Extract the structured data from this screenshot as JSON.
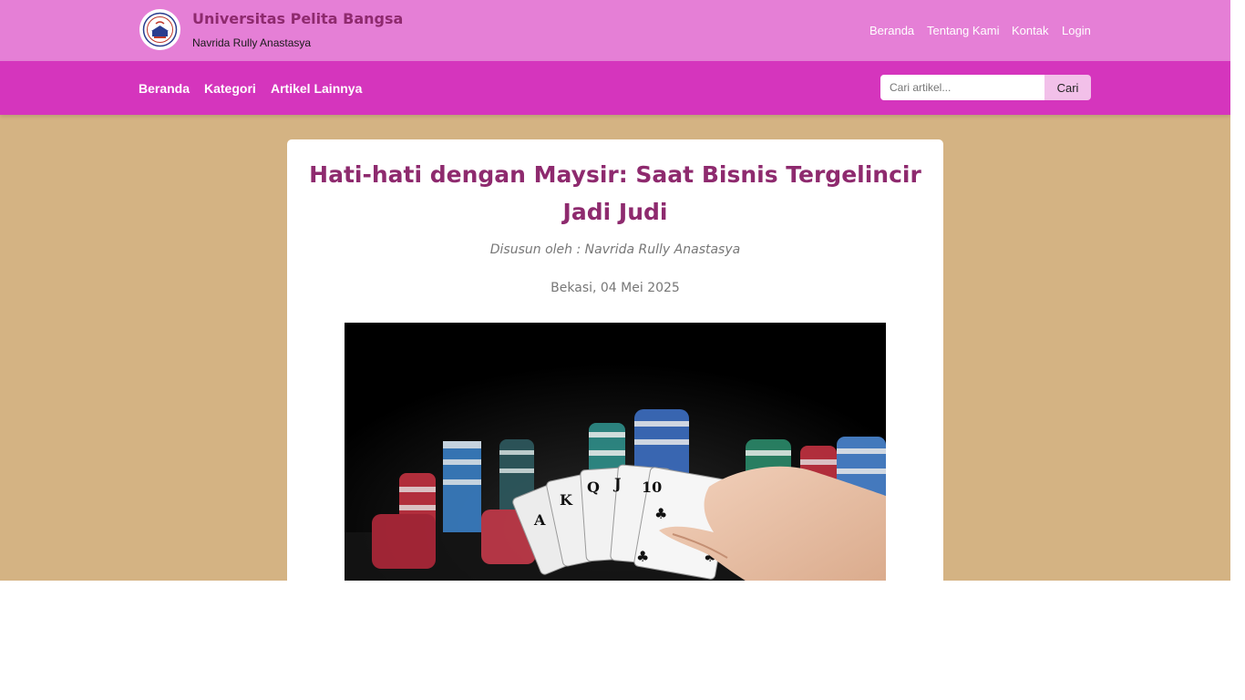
{
  "header": {
    "site_title": "Universitas Pelita Bangsa",
    "site_subtitle": "Navrida Rully Anastasya",
    "logo_icon": "university-seal-icon",
    "top_links": [
      "Beranda",
      "Tentang Kami",
      "Kontak",
      "Login"
    ]
  },
  "navbar": {
    "items": [
      "Beranda",
      "Kategori",
      "Artikel Lainnya"
    ],
    "search_placeholder": "Cari artikel...",
    "search_button": "Cari"
  },
  "article": {
    "title": "Hati-hati dengan Maysir: Saat Bisnis Tergelincir Jadi Judi",
    "author": "Disusun oleh : Navrida Rully Anastasya",
    "date": "Bekasi, 04 Mei 2025",
    "hero_image": "casino-chips-and-playing-cards-photo"
  },
  "colors": {
    "topbar": "#e57fd6",
    "navbar": "#d535bd",
    "page_background": "#d4b383",
    "title_color": "#8e2a6e"
  }
}
